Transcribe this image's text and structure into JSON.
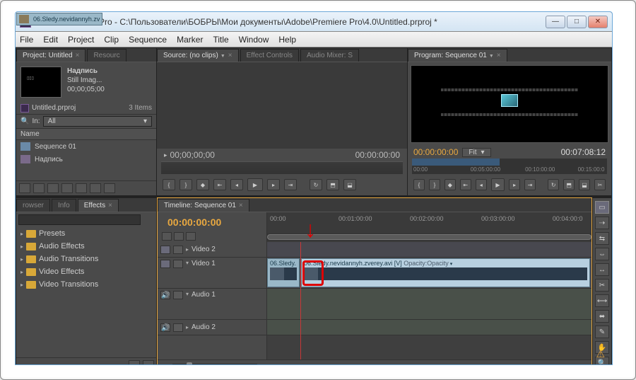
{
  "window": {
    "appIcon": "Pr",
    "title": "Adobe Premiere Pro - C:\\Пользователи\\БОБРЫ\\Мои документы\\Adobe\\Premiere Pro\\4.0\\Untitled.prproj *"
  },
  "menu": [
    "File",
    "Edit",
    "Project",
    "Clip",
    "Sequence",
    "Marker",
    "Title",
    "Window",
    "Help"
  ],
  "projectPanel": {
    "tabs": [
      "Project: Untitled",
      "Resourc"
    ],
    "selectedClip": {
      "name": "Надпись",
      "type": "Still Imag...",
      "duration": "00;00;05;00"
    },
    "projectFile": "Untitled.prproj",
    "itemCount": "3 Items",
    "filterLabel": "In:",
    "filterValue": "All",
    "nameHeader": "Name",
    "items": [
      {
        "label": "Sequence 01",
        "kind": "seq"
      },
      {
        "label": "06.Sledy.nevidannyh.zv",
        "kind": "clip"
      },
      {
        "label": "Надпись",
        "kind": "title"
      }
    ]
  },
  "sourcePanel": {
    "tabs": [
      "Source: (no clips)",
      "Effect Controls",
      "Audio Mixer: S"
    ],
    "tcLeft": "00;00;00;00",
    "tcRight": "00:00:00:00"
  },
  "programPanel": {
    "tab": "Program: Sequence 01",
    "tcCurrent": "00:00:00:00",
    "fitLabel": "Fit",
    "tcDuration": "00:07:08:12",
    "rulerTicks": [
      "00:00",
      "00:05:00:00",
      "00:10:00:00",
      "00:15:00:0"
    ]
  },
  "effectsPanel": {
    "tabs": [
      "rowser",
      "Info",
      "Effects"
    ],
    "placeholder": "",
    "folders": [
      "Presets",
      "Audio Effects",
      "Audio Transitions",
      "Video Effects",
      "Video Transitions"
    ]
  },
  "timeline": {
    "tab": "Timeline: Sequence 01",
    "timecode": "00:00:00:00",
    "rulerTicks": [
      "00:00",
      "00:01:00:00",
      "00:02:00:00",
      "00:03:00:00",
      "00:04:00:0"
    ],
    "tracks": {
      "video2": "Video 2",
      "video1": "Video 1",
      "audio1": "Audio 1",
      "audio2": "Audio 2"
    },
    "clips": {
      "clip1": "06.Sledy.",
      "clip2": "06.Sledy.nevidannyh.zverey.avi [V]",
      "clip2Effect": "Opacity:Opacity"
    }
  },
  "tools": [
    "select",
    "track-select",
    "ripple",
    "rolling",
    "rate",
    "razor",
    "slip",
    "slide",
    "pen",
    "hand",
    "zoom"
  ]
}
